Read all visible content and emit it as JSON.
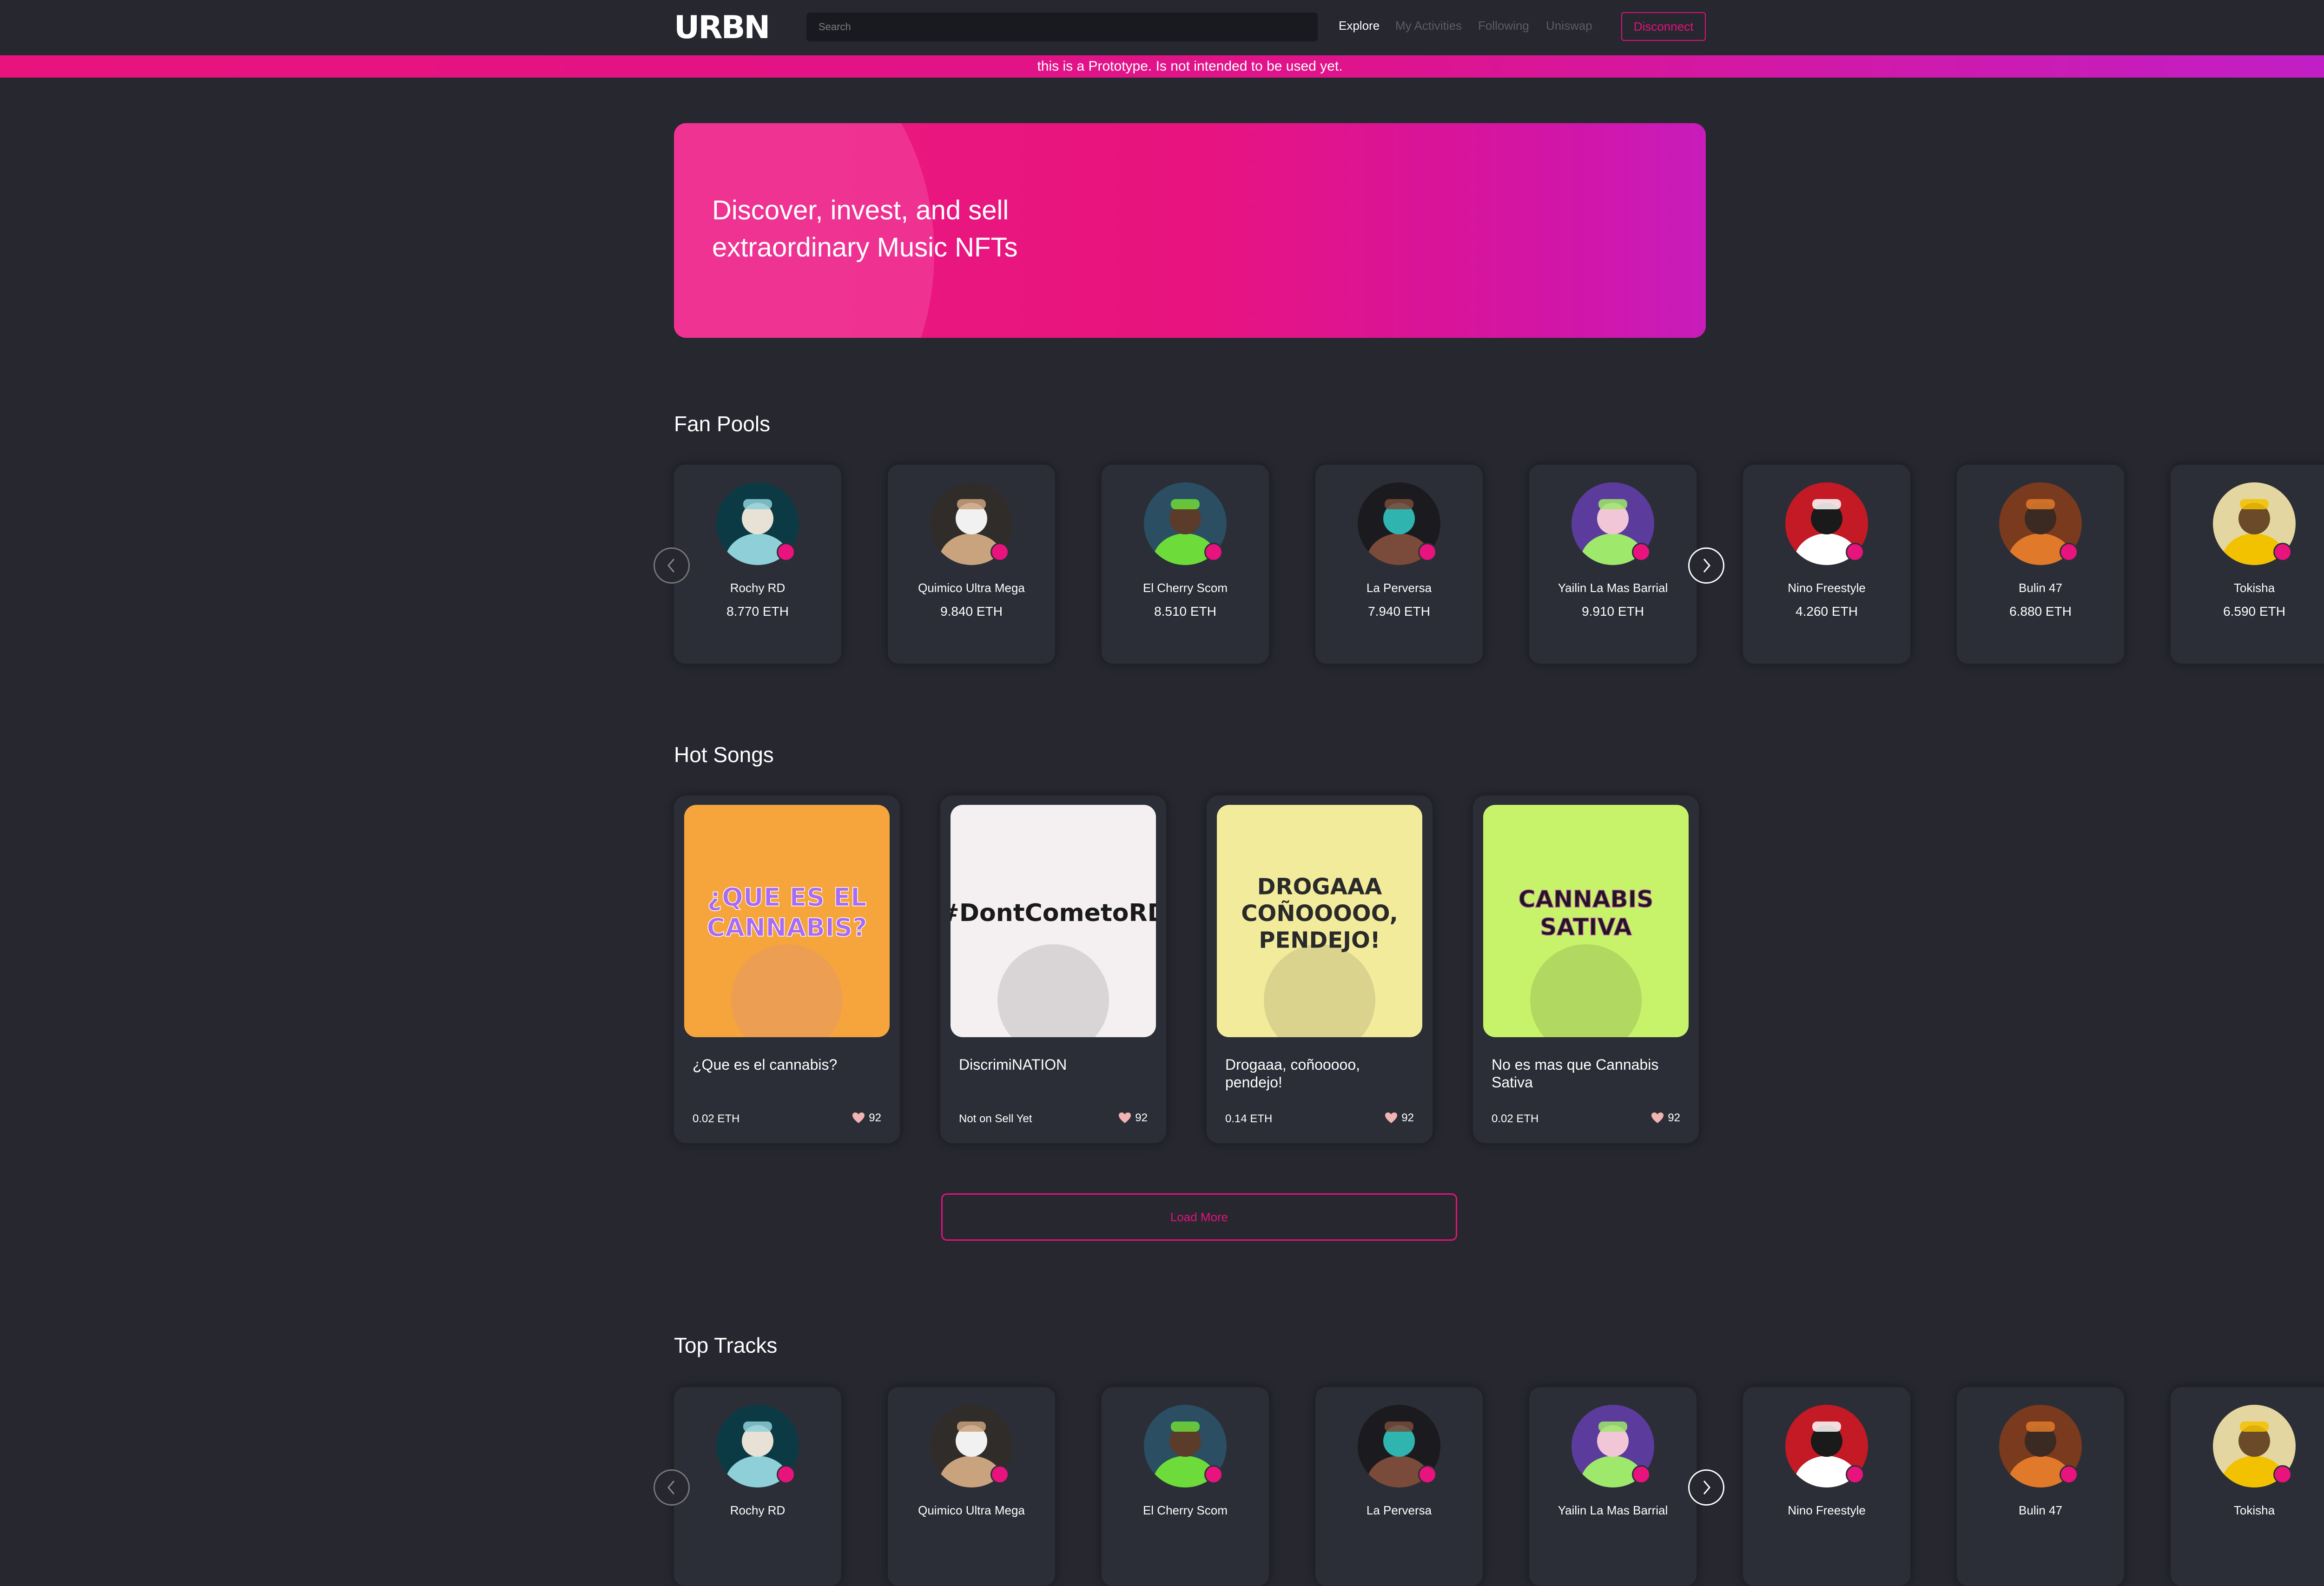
{
  "nav": {
    "logo_text": "URBN",
    "search_placeholder": "Search",
    "links": [
      "Explore",
      "My Activities",
      "Following",
      "Uniswap"
    ],
    "disconnect_label": "Disconnect"
  },
  "banner": {
    "text": "this is a Prototype. Is not intended to be used yet."
  },
  "hero": {
    "line1": "Discover, invest, and sell",
    "line2": "extraordinary Music NFTs"
  },
  "colors": {
    "accent": "#e8137d",
    "background": "#26272f",
    "card": "#2c2e37"
  },
  "fan_pools": {
    "title": "Fan Pools",
    "items": [
      {
        "name": "Rochy RD",
        "price": "8.770 ETH"
      },
      {
        "name": "Quimico Ultra Mega",
        "price": "9.840 ETH"
      },
      {
        "name": "El Cherry Scom",
        "price": "8.510 ETH"
      },
      {
        "name": "La Perversa",
        "price": "7.940 ETH"
      },
      {
        "name": "Yailin La Mas Barrial",
        "price": "9.910 ETH"
      },
      {
        "name": "Nino Freestyle",
        "price": "4.260 ETH"
      },
      {
        "name": "Bulin 47",
        "price": "6.880 ETH"
      },
      {
        "name": "Tokisha",
        "price": "6.590 ETH"
      }
    ]
  },
  "hot_songs": {
    "title": "Hot Songs",
    "items": [
      {
        "title": "¿Que es el cannabis?",
        "price": "0.02 ETH",
        "likes": "92",
        "art_text": "¿QUE ES EL CANNABIS?"
      },
      {
        "title": "DiscrimiNATION",
        "price": "Not on Sell Yet",
        "likes": "92",
        "art_text": "#DontCometoRD"
      },
      {
        "title": "Drogaaa, coñooooo, pendejo!",
        "price": "0.14 ETH",
        "likes": "92",
        "art_text": "DROGAAA COÑOOOOO, PENDEJO!"
      },
      {
        "title": "No es mas que Cannabis Sativa",
        "price": "0.02 ETH",
        "likes": "92",
        "art_text": "CANNABIS SATIVA"
      }
    ]
  },
  "load_more_label": "Load More",
  "top_tracks": {
    "title": "Top Tracks",
    "items": [
      {
        "name": "Rochy RD"
      },
      {
        "name": "Quimico Ultra Mega"
      },
      {
        "name": "El Cherry Scom"
      },
      {
        "name": "La Perversa"
      },
      {
        "name": "Yailin La Mas Barrial"
      },
      {
        "name": "Nino Freestyle"
      },
      {
        "name": "Bulin 47"
      },
      {
        "name": "Tokisha"
      }
    ]
  }
}
